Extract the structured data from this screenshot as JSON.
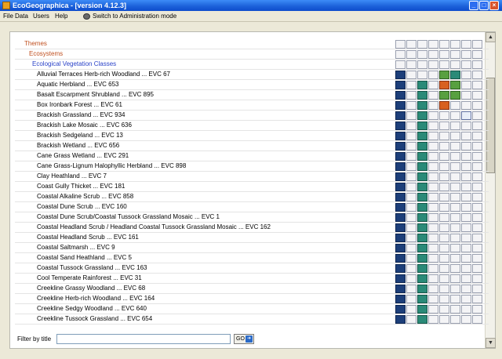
{
  "window": {
    "title": "EcoGeographica - [version 4.12.3]",
    "minimize_glyph": "_",
    "maximize_glyph": "□",
    "close_glyph": "×"
  },
  "menu": {
    "file": "File",
    "data": "Data",
    "users": "Users",
    "help": "Help",
    "admin": "Switch to Administration mode"
  },
  "tree": {
    "themes": "Themes",
    "ecosystems": "Ecosystems",
    "evc": "Ecological Vegetation Classes",
    "items": [
      "Alluvial Terraces Herb-rich Woodland ... EVC 67",
      "Aquatic Herbland ... EVC 653",
      "Basalt Escarpment Shrubland ... EVC 895",
      "Box Ironbark Forest ... EVC 61",
      "Brackish Grassland ... EVC 934",
      "Brackish Lake Mosaic ... EVC 636",
      "Brackish Sedgeland ... EVC 13",
      "Brackish Wetland ... EVC 656",
      "Cane Grass Wetland ... EVC 291",
      "Cane Grass-Lignum Halophyllic Herbland ... EVC 898",
      "Clay Heathland ... EVC 7",
      "Coast Gully Thicket ... EVC 181",
      "Coastal Alkaline Scrub ... EVC 858",
      "Coastal Dune Scrub ... EVC 160",
      "Coastal Dune Scrub/Coastal Tussock Grassland Mosaic ... EVC 1",
      "Coastal Headland Scrub / Headland Coastal Tussock Grassland Mosaic ... EVC 162",
      "Coastal Headland Scrub ... EVC 161",
      "Coastal Saltmarsh ... EVC 9",
      "Coastal Sand Heathland ... EVC 5",
      "Coastal Tussock Grassland ... EVC 163",
      "Cool Temperate Rainforest ... EVC 31",
      "Creekline Grassy Woodland ... EVC 68",
      "Creekline Herb-rich Woodland ... EVC 164",
      "Creekline Sedgy Woodland ... EVC 640",
      "Creekline Tussock Grassland ... EVC 654"
    ]
  },
  "filter": {
    "label": "Filter by title",
    "value": "",
    "go_label": "GO",
    "go_icon": "➜"
  },
  "scroll": {
    "up": "▲",
    "down": "▼"
  }
}
